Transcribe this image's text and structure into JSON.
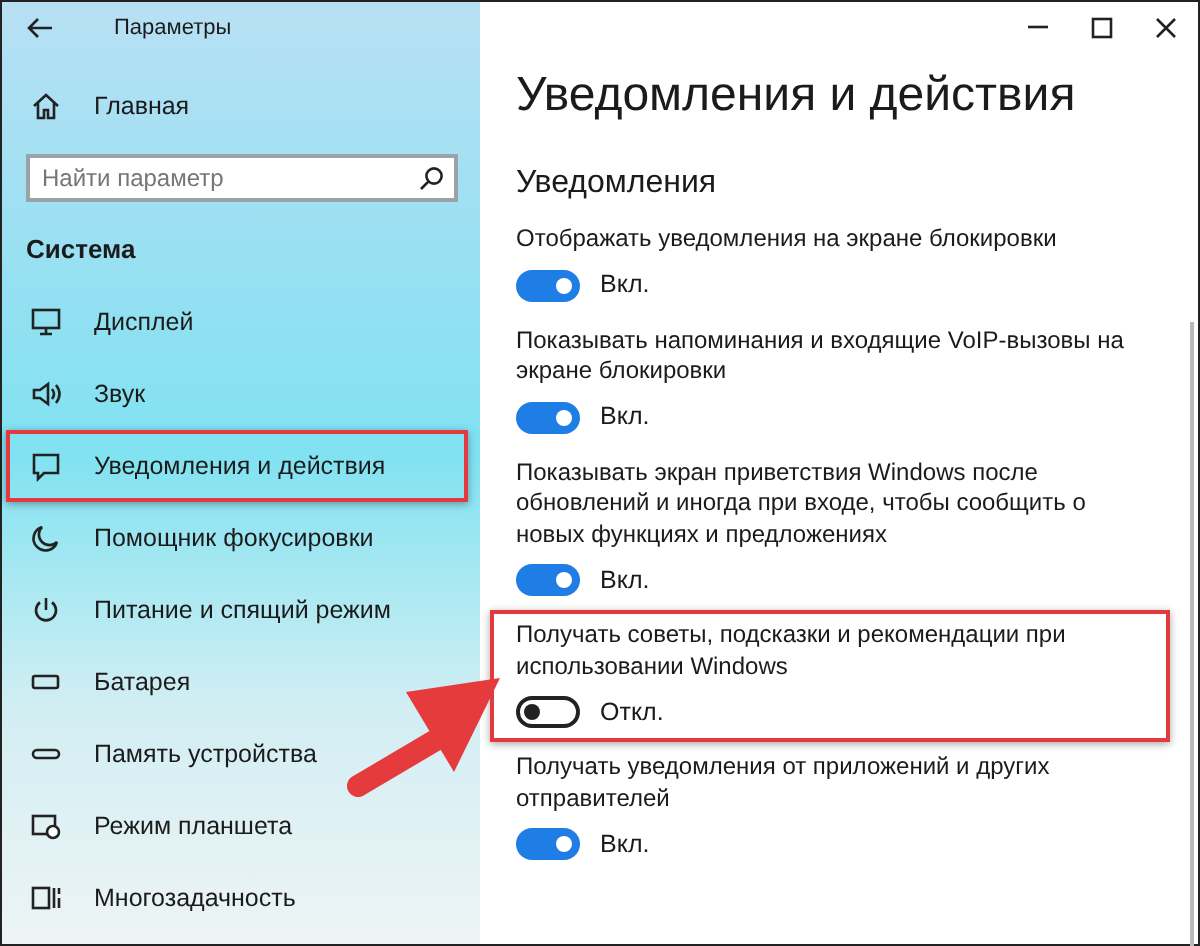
{
  "window": {
    "title": "Параметры"
  },
  "sidebar": {
    "home": "Главная",
    "search": {
      "placeholder": "Найти параметр"
    },
    "section": "Система",
    "items": [
      {
        "label": "Дисплей",
        "highlighted": false
      },
      {
        "label": "Звук",
        "highlighted": false
      },
      {
        "label": "Уведомления и действия",
        "highlighted": true
      },
      {
        "label": "Помощник фокусировки",
        "highlighted": false
      },
      {
        "label": "Питание и спящий режим",
        "highlighted": false
      },
      {
        "label": "Батарея",
        "highlighted": false
      },
      {
        "label": "Память устройства",
        "highlighted": false
      },
      {
        "label": "Режим планшета",
        "highlighted": false
      },
      {
        "label": "Многозадачность",
        "highlighted": false
      }
    ]
  },
  "page": {
    "title": "Уведомления и действия",
    "section": "Уведомления",
    "settings": [
      {
        "label": "Отображать уведомления на экране блокировки",
        "on": true,
        "state_text": "Вкл.",
        "highlighted": false
      },
      {
        "label": "Показывать напоминания и входящие VoIP-вызовы на экране блокировки",
        "on": true,
        "state_text": "Вкл.",
        "highlighted": false
      },
      {
        "label": "Показывать экран приветствия Windows после обновлений и иногда при входе, чтобы сообщить о новых функциях и предложениях",
        "on": true,
        "state_text": "Вкл.",
        "highlighted": false
      },
      {
        "label": "Получать советы, подсказки и рекомендации при использовании Windows",
        "on": false,
        "state_text": "Откл.",
        "highlighted": true
      },
      {
        "label": "Получать уведомления от приложений и других отправителей",
        "on": true,
        "state_text": "Вкл.",
        "highlighted": false
      }
    ]
  }
}
